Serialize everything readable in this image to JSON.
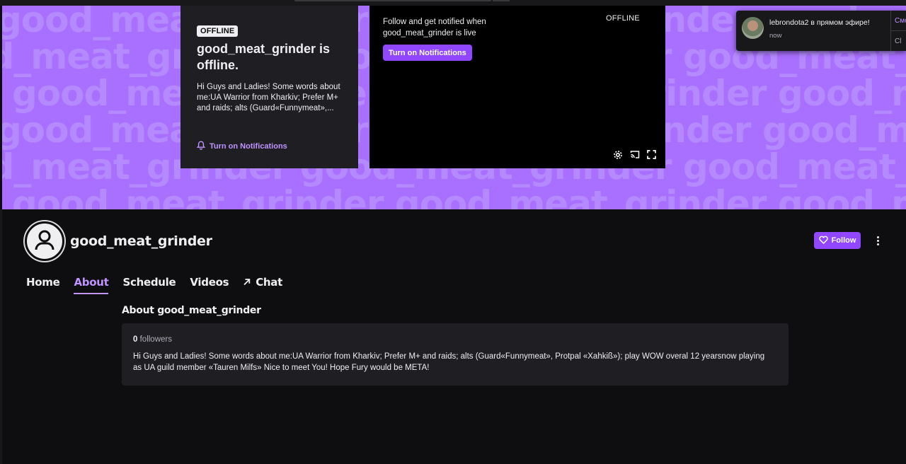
{
  "banner": {
    "bg_text": "good_meat_grinder"
  },
  "offline_card": {
    "badge": "OFFLINE",
    "title": "good_meat_grinder is offline.",
    "description": "Hi Guys and Ladies! Some words about me:UA Warrior from Kharkiv; Prefer M+ and raids; alts (Guard«Funnymeat»,...",
    "notif_label": "Turn on Notifications"
  },
  "player": {
    "follow_text": "Follow and get notified when good_meat_grinder is live",
    "notif_button": "Turn on Notifications",
    "status": "OFFLINE",
    "controls": [
      "gear-icon",
      "cast-icon",
      "fullscreen-icon"
    ]
  },
  "toast": {
    "message": "lebrondota2 в прямом эфире!",
    "time": "now",
    "watch_label": "Смот",
    "close_label": "Cl"
  },
  "channel": {
    "name": "good_meat_grinder",
    "follow_label": "Follow"
  },
  "tabs": [
    {
      "label": "Home"
    },
    {
      "label": "About"
    },
    {
      "label": "Schedule"
    },
    {
      "label": "Videos"
    },
    {
      "label": "Chat"
    }
  ],
  "about": {
    "title": "About good_meat_grinder",
    "followers_count": "0",
    "followers_label": "followers",
    "bio": "Hi Guys and Ladies! Some words about me:UA Warrior from Kharkiv; Prefer M+ and raids; alts (Guard«Funnymeat», Protpal «Xahkiß»); play WOW overal 12 yearsnow playing as UA guild member «Tauren Milfs» Nice to meet You! Hope Fury would be META!"
  },
  "colors": {
    "accent": "#9147ff",
    "accent_light": "#bf94ff",
    "banner": "#a970ff",
    "background": "#0e0e10",
    "card": "#1f1f23"
  }
}
